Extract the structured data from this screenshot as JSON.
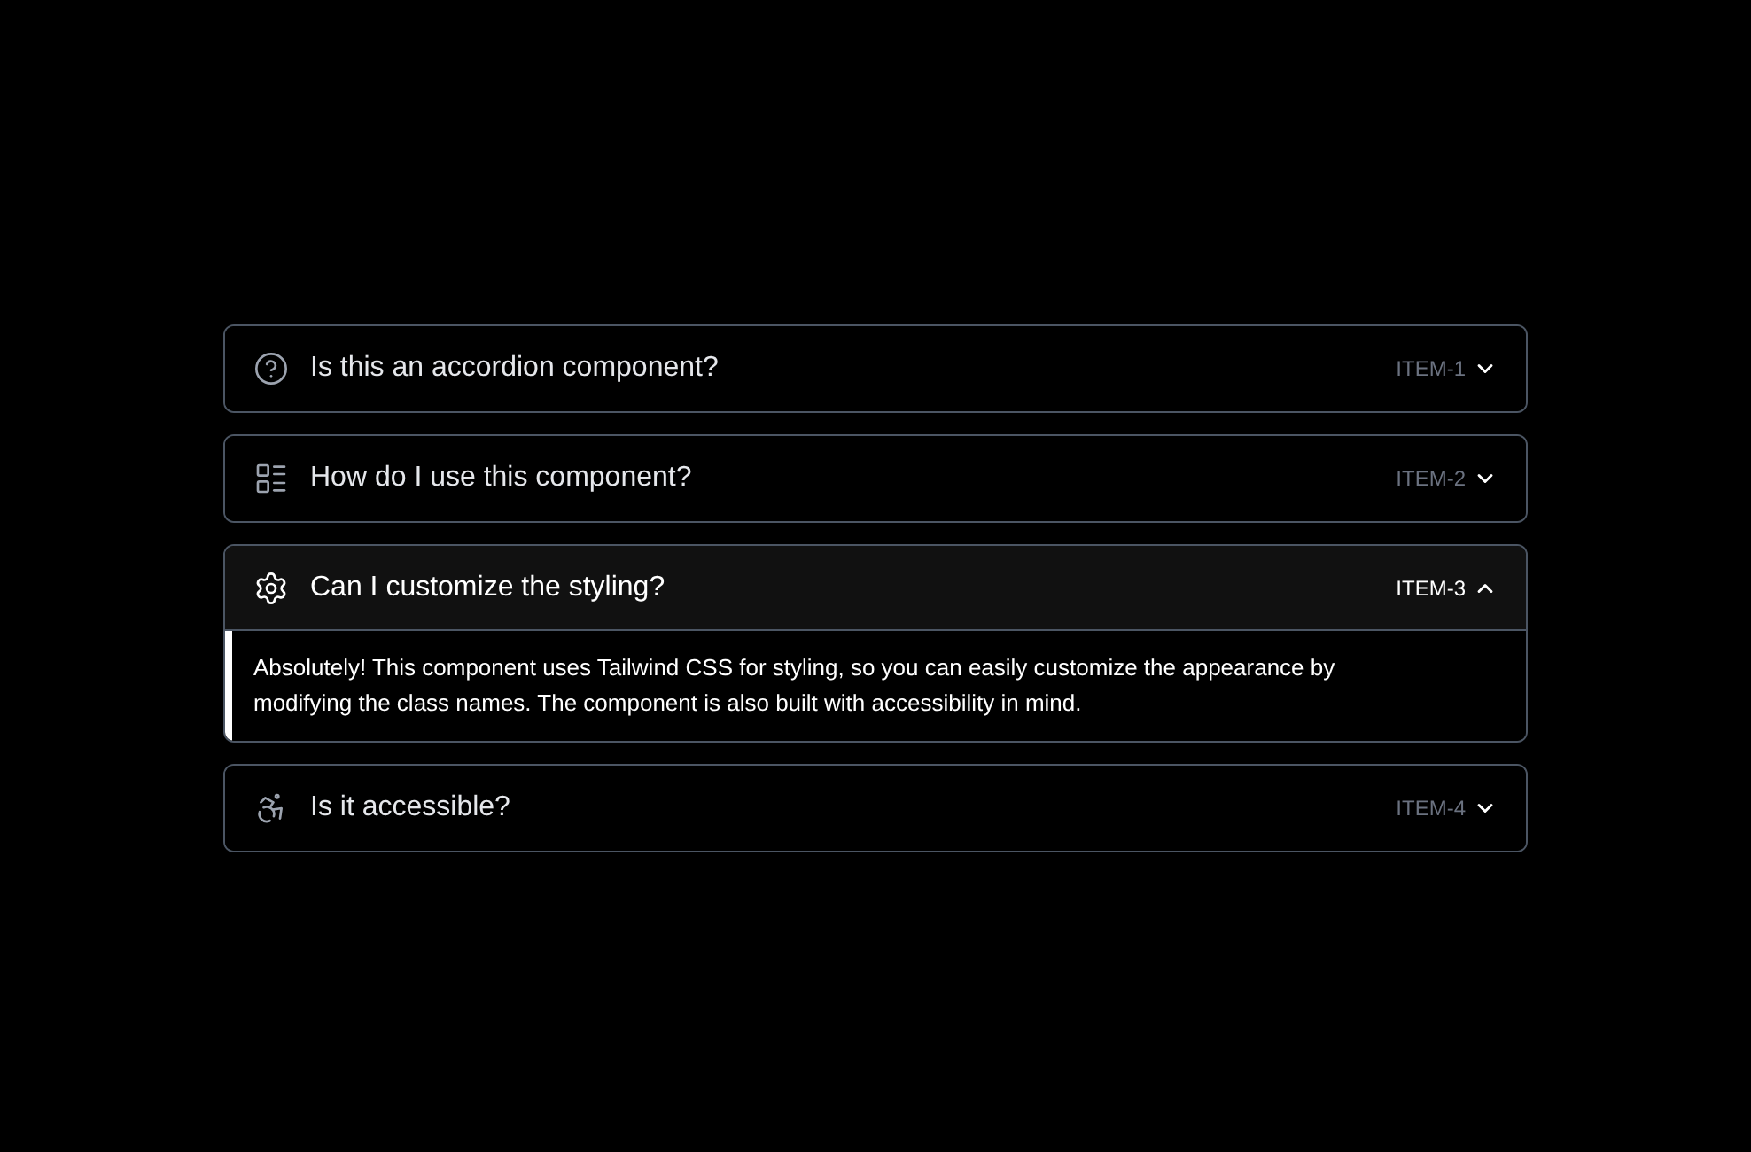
{
  "items": [
    {
      "question": "Is this an accordion component?",
      "tag": "ITEM-1",
      "expanded": false
    },
    {
      "question": "How do I use this component?",
      "tag": "ITEM-2",
      "expanded": false
    },
    {
      "question": "Can I customize the styling?",
      "tag": "ITEM-3",
      "expanded": true,
      "answer": "Absolutely! This component uses Tailwind CSS for styling, so you can easily customize the appearance by modifying the class names. The component is also built with accessibility in mind."
    },
    {
      "question": "Is it accessible?",
      "tag": "ITEM-4",
      "expanded": false
    }
  ]
}
